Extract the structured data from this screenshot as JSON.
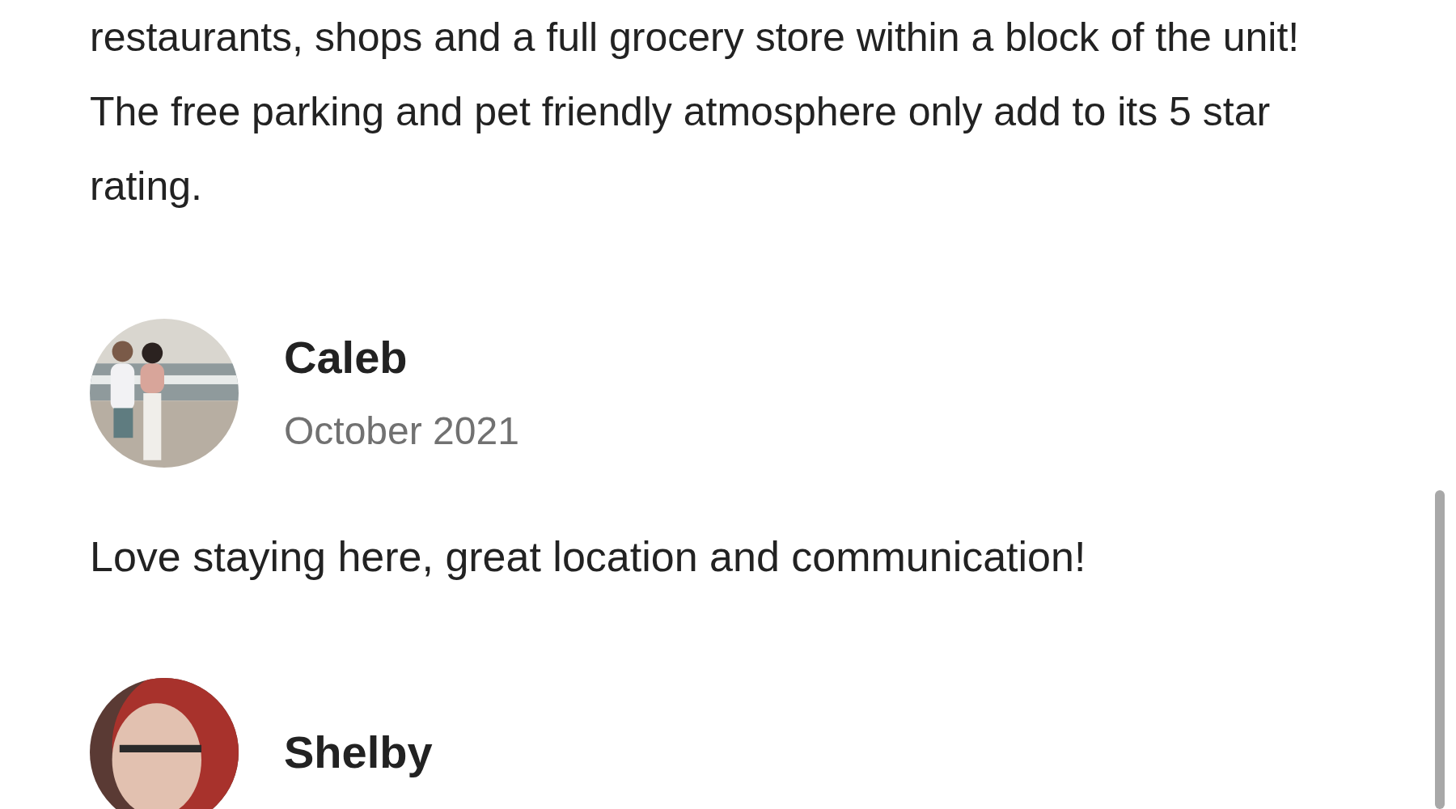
{
  "description": {
    "text": "restaurants, shops and a full grocery store within a block of the unit! The free parking and pet friendly atmosphere only add to its 5 star rating."
  },
  "reviews": [
    {
      "name": "Caleb",
      "date": "October 2021",
      "text": "Love staying here, great location and communication!"
    },
    {
      "name": "Shelby"
    }
  ]
}
